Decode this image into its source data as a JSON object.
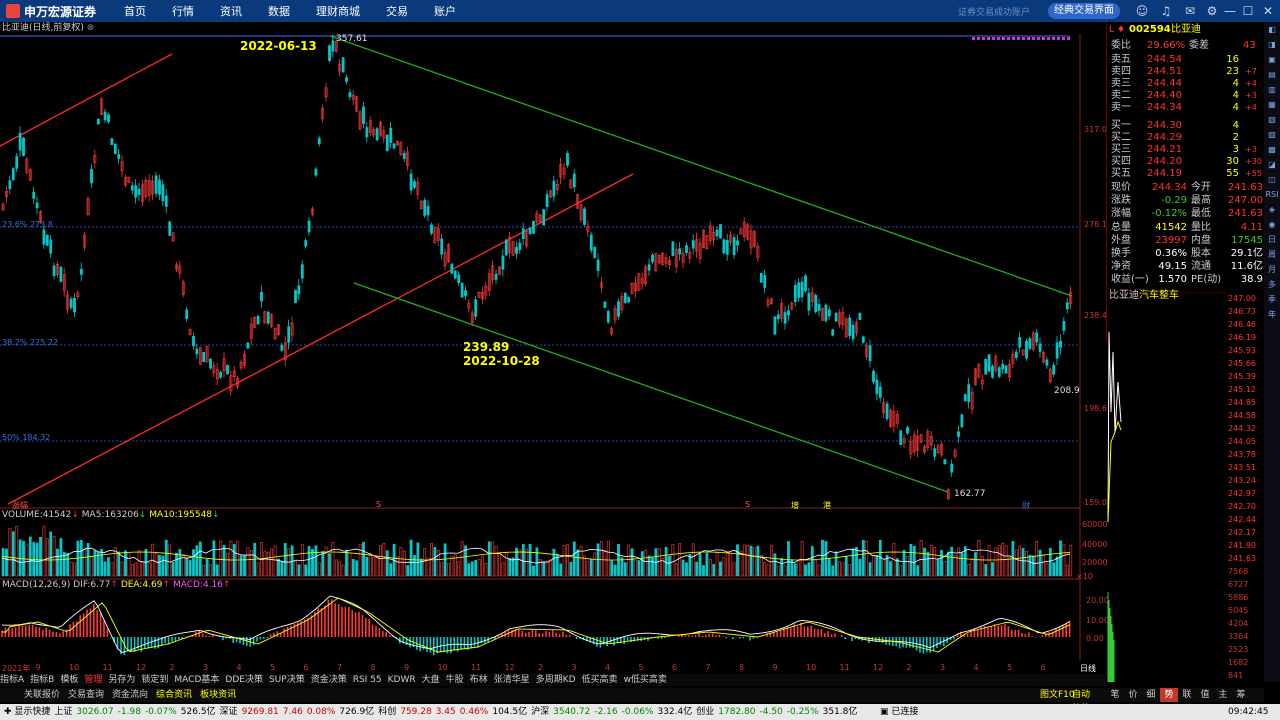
{
  "app": {
    "logo_text": "申万宏源证券",
    "slogan": "证券交易成功账户",
    "classic_btn": "经典交易界面",
    "nav": [
      "首页",
      "行情",
      "资讯",
      "数据",
      "理财商城",
      "交易",
      "账户"
    ]
  },
  "chart_title": "比亚迪(日线,前复权)",
  "main_chart": {
    "price_labels": [
      "317.0",
      "278.1",
      "238.4",
      "198.6",
      "159.0"
    ],
    "annotations": {
      "high_date": "2022-06-13",
      "high_value": "357.61",
      "low_price": "239.89",
      "low_date": "2022-10-28",
      "bottom_value": "162.77",
      "pos_value": "208.9"
    },
    "fib_labels": [
      "23.6% 273.8",
      "38.2% 225.22",
      "50% 184.32"
    ],
    "bottom_markers": [
      "涨幅",
      "S",
      "S",
      "增",
      "港",
      "财"
    ]
  },
  "volume": {
    "label": "VOLUME:",
    "value": "41542",
    "ma5_label": "MA5:",
    "ma5": "163206",
    "ma10_label": "MA10:",
    "ma10": "195548",
    "scale": [
      "60000",
      "40000",
      "20000",
      "×10"
    ]
  },
  "macd": {
    "label": "MACD(12,26,9)",
    "dif_label": "DIF:",
    "dif": "6.77",
    "dea_label": "DEA:",
    "dea": "4.69",
    "macd_label": "MACD:",
    "macd_val": "4.16",
    "scale": [
      "20.00",
      "10.00",
      "0.00"
    ]
  },
  "x_axis": [
    "2021年",
    "9",
    "10",
    "11",
    "12",
    "2",
    "3",
    "4",
    "5",
    "6",
    "7",
    "8",
    "9",
    "10",
    "11",
    "12",
    "2",
    "3",
    "4",
    "5",
    "6",
    "7",
    "8",
    "9",
    "10",
    "11",
    "12",
    "2",
    "3",
    "4",
    "5",
    "6",
    "日线"
  ],
  "stock": {
    "code": "002594",
    "name": "比亚迪",
    "weibi_label": "委比",
    "weibi": "29.66%",
    "weicha_label": "委差",
    "weicha": "43",
    "asks": [
      {
        "label": "卖五",
        "price": "244.54",
        "vol": "16",
        "chg": ""
      },
      {
        "label": "卖四",
        "price": "244.51",
        "vol": "23",
        "chg": "+7"
      },
      {
        "label": "卖三",
        "price": "244.44",
        "vol": "4",
        "chg": "+4"
      },
      {
        "label": "卖二",
        "price": "244.40",
        "vol": "4",
        "chg": "+3"
      },
      {
        "label": "卖一",
        "price": "244.34",
        "vol": "4",
        "chg": "+4"
      }
    ],
    "bids": [
      {
        "label": "买一",
        "price": "244.30",
        "vol": "4",
        "chg": ""
      },
      {
        "label": "买二",
        "price": "244.29",
        "vol": "2",
        "chg": ""
      },
      {
        "label": "买三",
        "price": "244.21",
        "vol": "3",
        "chg": "+3"
      },
      {
        "label": "买四",
        "price": "244.20",
        "vol": "30",
        "chg": "+30"
      },
      {
        "label": "买五",
        "price": "244.19",
        "vol": "55",
        "chg": "+55"
      }
    ],
    "stats": [
      {
        "l1": "现价",
        "v1": "244.34",
        "c1": "#ff3333",
        "l2": "今开",
        "v2": "241.63",
        "c2": "#ff3333"
      },
      {
        "l1": "涨跌",
        "v1": "-0.29",
        "c1": "#33cc33",
        "l2": "最高",
        "v2": "247.00",
        "c2": "#ff3333"
      },
      {
        "l1": "涨幅",
        "v1": "-0.12%",
        "c1": "#33cc33",
        "l2": "最低",
        "v2": "241.63",
        "c2": "#ff3333"
      },
      {
        "l1": "总量",
        "v1": "41542",
        "c1": "#ffff00",
        "l2": "量比",
        "v2": "4.11",
        "c2": "#ff3333"
      },
      {
        "l1": "外盘",
        "v1": "23997",
        "c1": "#ff3333",
        "l2": "内盘",
        "v2": "17545",
        "c2": "#33cc33"
      },
      {
        "l1": "换手",
        "v1": "0.36%",
        "c1": "#ffffff",
        "l2": "股本",
        "v2": "29.1亿",
        "c2": "#ffffff"
      },
      {
        "l1": "净资",
        "v1": "49.15",
        "c1": "#ffffff",
        "l2": "流通",
        "v2": "11.6亿",
        "c2": "#ffffff"
      },
      {
        "l1": "收益(一)",
        "v1": "1.570",
        "c1": "#ffffff",
        "l2": "PE(动)",
        "v2": "38.9",
        "c2": "#ffffff"
      }
    ],
    "sector_name": "比亚迪",
    "sector_link": "汽车整车"
  },
  "intraday_scale": [
    "247.00",
    "246.73",
    "246.46",
    "246.19",
    "245.93",
    "245.66",
    "245.39",
    "245.12",
    "244.85",
    "244.58",
    "244.32",
    "244.05",
    "243.78",
    "243.51",
    "243.24",
    "242.97",
    "242.70",
    "242.44",
    "242.17",
    "241.90",
    "241.63",
    "7568",
    "6727",
    "5886",
    "5045",
    "4204",
    "3364",
    "2523",
    "1682",
    "841"
  ],
  "bottom_tabs": [
    "指标A",
    "指标B",
    "模板",
    "管理",
    "另存为",
    "锁定到",
    "MACD基本",
    "DDE决策",
    "SUP决策",
    "资金决策",
    "RSI 55",
    "KDWR",
    "大盘",
    "牛股",
    "布林",
    "张清华星",
    "多周期KD",
    "低买高卖",
    "w低买高卖"
  ],
  "info_tabs": [
    "关联报价",
    "交易查询",
    "资金流向",
    "综合资讯",
    "板块资讯"
  ],
  "info_right": [
    "图文F10",
    "自动缩放"
  ],
  "right_tabs": [
    "笔",
    "价",
    "细",
    "势",
    "联",
    "值",
    "主",
    "筹"
  ],
  "side_icons": [
    "◧",
    "◨",
    "▣",
    "▤",
    "▥",
    "▦",
    "▧",
    "▨",
    "▩",
    "◪",
    "◫",
    "RSI",
    "◈",
    "◉",
    "日",
    "周",
    "月",
    "多",
    "季",
    "年"
  ],
  "status": {
    "start": "显示快捷",
    "items": [
      {
        "name": "上证",
        "val": "3026.07",
        "chg": "-1.98",
        "pct": "-0.07%",
        "amt": "526.5亿"
      },
      {
        "name": "深证",
        "val": "9269.81",
        "chg": "7.46",
        "pct": "0.08%",
        "amt": "726.9亿"
      },
      {
        "name": "科创",
        "val": "759.28",
        "chg": "3.45",
        "pct": "0.46%",
        "amt": "104.5亿"
      },
      {
        "name": "沪深",
        "val": "3540.72",
        "chg": "-2.16",
        "pct": "-0.06%",
        "amt": "332.4亿"
      },
      {
        "name": "创业",
        "val": "1782.80",
        "chg": "-4.50",
        "pct": "-0.25%",
        "amt": "351.8亿"
      }
    ],
    "connect": "已连接",
    "clock": "09:42:45"
  },
  "colors": {
    "up": "#ff3333",
    "down": "#00cccc",
    "green": "#33cc33",
    "yellow": "#ffff00",
    "blue": "#5555ff",
    "nav": "#0b3a7c"
  }
}
